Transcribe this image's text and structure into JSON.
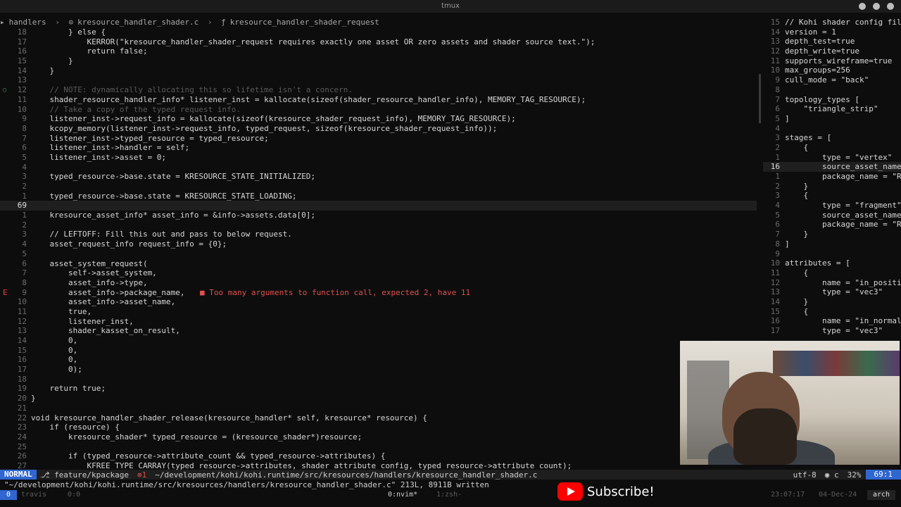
{
  "window": {
    "title": "tmux"
  },
  "breadcrumbs": [
    "handlers",
    "kresource_handler_shader.c",
    "kresource_handler_shader_request"
  ],
  "left_lines": [
    {
      "n": "18",
      "code": "        } else {"
    },
    {
      "n": "17",
      "code": "            KERROR(\"kresource_handler_shader_request requires exactly one asset OR zero assets and shader source text.\");"
    },
    {
      "n": "16",
      "code": "            return false;"
    },
    {
      "n": "15",
      "code": "        }"
    },
    {
      "n": "14",
      "code": "    }"
    },
    {
      "n": "13",
      "code": ""
    },
    {
      "n": "12",
      "code": "    // NOTE: dynamically allocating this so lifetime isn't a concern.",
      "comment": true,
      "sign": "info"
    },
    {
      "n": "11",
      "code": "    shader_resource_handler_info* listener_inst = kallocate(sizeof(shader_resource_handler_info), MEMORY_TAG_RESOURCE);"
    },
    {
      "n": "10",
      "code": "    // Take a copy of the typed request info.",
      "comment": true
    },
    {
      "n": "9",
      "code": "    listener_inst->request_info = kallocate(sizeof(kresource_shader_request_info), MEMORY_TAG_RESOURCE);"
    },
    {
      "n": "8",
      "code": "    kcopy_memory(listener_inst->request_info, typed_request, sizeof(kresource_shader_request_info));"
    },
    {
      "n": "7",
      "code": "    listener_inst->typed_resource = typed_resource;"
    },
    {
      "n": "6",
      "code": "    listener_inst->handler = self;"
    },
    {
      "n": "5",
      "code": "    listener_inst->asset = 0;"
    },
    {
      "n": "4",
      "code": ""
    },
    {
      "n": "3",
      "code": "    typed_resource->base.state = KRESOURCE_STATE_INITIALIZED;"
    },
    {
      "n": "2",
      "code": ""
    },
    {
      "n": "1",
      "code": "    typed_resource->base.state = KRESOURCE_STATE_LOADING;"
    },
    {
      "n": "69",
      "code": "",
      "current": true
    },
    {
      "n": "1",
      "code": "    kresource_asset_info* asset_info = &info->assets.data[0];"
    },
    {
      "n": "2",
      "code": ""
    },
    {
      "n": "3",
      "code": "    // LEFTOFF: Fill this out and pass to below request."
    },
    {
      "n": "4",
      "code": "    asset_request_info request_info = {0};"
    },
    {
      "n": "5",
      "code": ""
    },
    {
      "n": "6",
      "code": "    asset_system_request("
    },
    {
      "n": "7",
      "code": "        self->asset_system,"
    },
    {
      "n": "8",
      "code": "        asset_info->type,"
    },
    {
      "n": "9",
      "code": "        asset_info->package_name,",
      "sign": "E",
      "diag": "■ Too many arguments to function call, expected 2, have 11"
    },
    {
      "n": "10",
      "code": "        asset_info->asset_name,"
    },
    {
      "n": "11",
      "code": "        true,"
    },
    {
      "n": "12",
      "code": "        listener_inst,"
    },
    {
      "n": "13",
      "code": "        shader_kasset_on_result,"
    },
    {
      "n": "14",
      "code": "        0,"
    },
    {
      "n": "15",
      "code": "        0,"
    },
    {
      "n": "16",
      "code": "        0,"
    },
    {
      "n": "17",
      "code": "        0);"
    },
    {
      "n": "18",
      "code": ""
    },
    {
      "n": "19",
      "code": "    return true;"
    },
    {
      "n": "20",
      "code": "}"
    },
    {
      "n": "21",
      "code": ""
    },
    {
      "n": "22",
      "code": "void kresource_handler_shader_release(kresource_handler* self, kresource* resource) {"
    },
    {
      "n": "23",
      "code": "    if (resource) {"
    },
    {
      "n": "24",
      "code": "        kresource_shader* typed_resource = (kresource_shader*)resource;"
    },
    {
      "n": "25",
      "code": ""
    },
    {
      "n": "26",
      "code": "        if (typed_resource->attribute_count && typed_resource->attributes) {"
    },
    {
      "n": "27",
      "code": "            KFREE_TYPE_CARRAY(typed_resource->attributes, shader_attribute_config, typed_resource->attribute_count);"
    }
  ],
  "right_lines": [
    {
      "n": "15",
      "code": "// Kohi shader config fil"
    },
    {
      "n": "14",
      "code": "version = 1"
    },
    {
      "n": "13",
      "code": "depth_test=true"
    },
    {
      "n": "12",
      "code": "depth_write=true"
    },
    {
      "n": "11",
      "code": "supports_wireframe=true"
    },
    {
      "n": "10",
      "code": "max_groups=256"
    },
    {
      "n": "9",
      "code": "cull_mode = \"back\""
    },
    {
      "n": "8",
      "code": ""
    },
    {
      "n": "7",
      "code": "topology_types ["
    },
    {
      "n": "6",
      "code": "    \"triangle_strip\""
    },
    {
      "n": "5",
      "code": "]"
    },
    {
      "n": "4",
      "code": ""
    },
    {
      "n": "3",
      "code": "stages = ["
    },
    {
      "n": "2",
      "code": "    {"
    },
    {
      "n": "1",
      "code": "        type = \"vertex\""
    },
    {
      "n": "16",
      "code": "        source_asset_name",
      "current": true
    },
    {
      "n": "1",
      "code": "        package_name = \"R"
    },
    {
      "n": "2",
      "code": "    }"
    },
    {
      "n": "3",
      "code": "    {"
    },
    {
      "n": "4",
      "code": "        type = \"fragment\""
    },
    {
      "n": "5",
      "code": "        source_asset_name"
    },
    {
      "n": "6",
      "code": "        package_name = \"R"
    },
    {
      "n": "7",
      "code": "    }"
    },
    {
      "n": "8",
      "code": "]"
    },
    {
      "n": "9",
      "code": ""
    },
    {
      "n": "10",
      "code": "attributes = ["
    },
    {
      "n": "11",
      "code": "    {"
    },
    {
      "n": "12",
      "code": "        name = \"in_positi"
    },
    {
      "n": "13",
      "code": "        type = \"vec3\""
    },
    {
      "n": "14",
      "code": "    }"
    },
    {
      "n": "15",
      "code": "    {"
    },
    {
      "n": "16",
      "code": "        name = \"in_normal"
    },
    {
      "n": "17",
      "code": "        type = \"vec3\""
    }
  ],
  "statusline": {
    "mode": "NORMAL",
    "branch": "feature/kpackage",
    "errors": "1",
    "path": "~/development/kohi/kohi.runtime/src/kresources/handlers/kresource_handler_shader.c",
    "encoding": "utf-8",
    "filetype": "c",
    "percent": "32%",
    "position": "69:1"
  },
  "message": "\"~/development/kohi/kohi.runtime/src/kresources/handlers/kresource_handler_shader.c\" 213L, 8911B written",
  "tmux": {
    "index": "0",
    "host": "travis",
    "zero": "0:0",
    "window0": "0:nvim*",
    "window1": "1:zsh-",
    "time": "23:07:17",
    "date": "04-Dec-24",
    "os": "arch"
  },
  "overlay": {
    "subscribe_label": "Subscribe!"
  },
  "colors": {
    "accent": "#2f66d0",
    "error": "#e04040",
    "youtube": "#ff0000"
  }
}
